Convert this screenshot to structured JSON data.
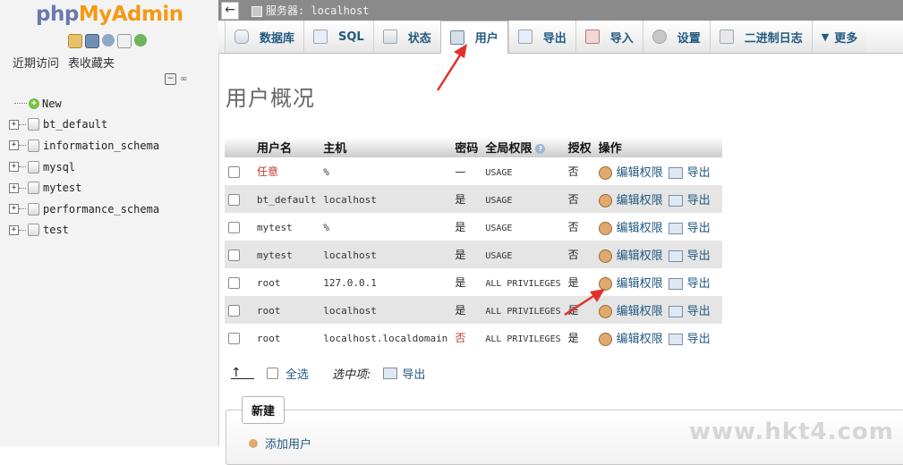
{
  "app": {
    "logo_part1": "php",
    "logo_part2": "MyAdmin"
  },
  "nav": {
    "tabs": [
      "近期访问",
      "表收藏夹"
    ],
    "tree_new": "New",
    "databases": [
      "bt_default",
      "information_schema",
      "mysql",
      "mytest",
      "performance_schema",
      "test"
    ]
  },
  "server_bar": {
    "label": "服务器: localhost"
  },
  "tabs": [
    {
      "label": "数据库",
      "icon": "database-icon"
    },
    {
      "label": "SQL",
      "icon": "sql-icon"
    },
    {
      "label": "状态",
      "icon": "status-icon"
    },
    {
      "label": "用户",
      "icon": "users-icon",
      "active": true
    },
    {
      "label": "导出",
      "icon": "export-icon"
    },
    {
      "label": "导入",
      "icon": "import-icon"
    },
    {
      "label": "设置",
      "icon": "settings-icon"
    },
    {
      "label": "二进制日志",
      "icon": "binlog-icon"
    },
    {
      "label": "更多",
      "icon": "more-dropdown-icon"
    }
  ],
  "page": {
    "title": "用户概况"
  },
  "table": {
    "headers": {
      "user": "用户名",
      "host": "主机",
      "password": "密码",
      "privileges": "全局权限",
      "grant": "授权",
      "action": "操作"
    },
    "rows": [
      {
        "user": "任意",
        "host": "%",
        "password": "—",
        "privileges": "USAGE",
        "grant": "否",
        "edit": "编辑权限",
        "export": "导出"
      },
      {
        "user": "bt_default",
        "host": "localhost",
        "password": "是",
        "privileges": "USAGE",
        "grant": "否",
        "edit": "编辑权限",
        "export": "导出"
      },
      {
        "user": "mytest",
        "host": "%",
        "password": "是",
        "privileges": "USAGE",
        "grant": "否",
        "edit": "编辑权限",
        "export": "导出"
      },
      {
        "user": "mytest",
        "host": "localhost",
        "password": "是",
        "privileges": "USAGE",
        "grant": "否",
        "edit": "编辑权限",
        "export": "导出"
      },
      {
        "user": "root",
        "host": "127.0.0.1",
        "password": "是",
        "privileges": "ALL PRIVILEGES",
        "grant": "是",
        "edit": "编辑权限",
        "export": "导出"
      },
      {
        "user": "root",
        "host": "localhost",
        "password": "是",
        "privileges": "ALL PRIVILEGES",
        "grant": "是",
        "edit": "编辑权限",
        "export": "导出"
      },
      {
        "user": "root",
        "host": "localhost.localdomain",
        "password": "否",
        "privileges": "ALL PRIVILEGES",
        "grant": "是",
        "edit": "编辑权限",
        "export": "导出"
      }
    ]
  },
  "bulk": {
    "select_all": "全选",
    "selected": "选中项:",
    "export": "导出"
  },
  "new_section": {
    "legend": "新建",
    "add_user": "添加用户"
  },
  "watermark": "www.hkt4.com",
  "colors": {
    "link": "#235a81",
    "annotation_arrow": "#e0322b",
    "server_bar": "#8a8a8a"
  }
}
